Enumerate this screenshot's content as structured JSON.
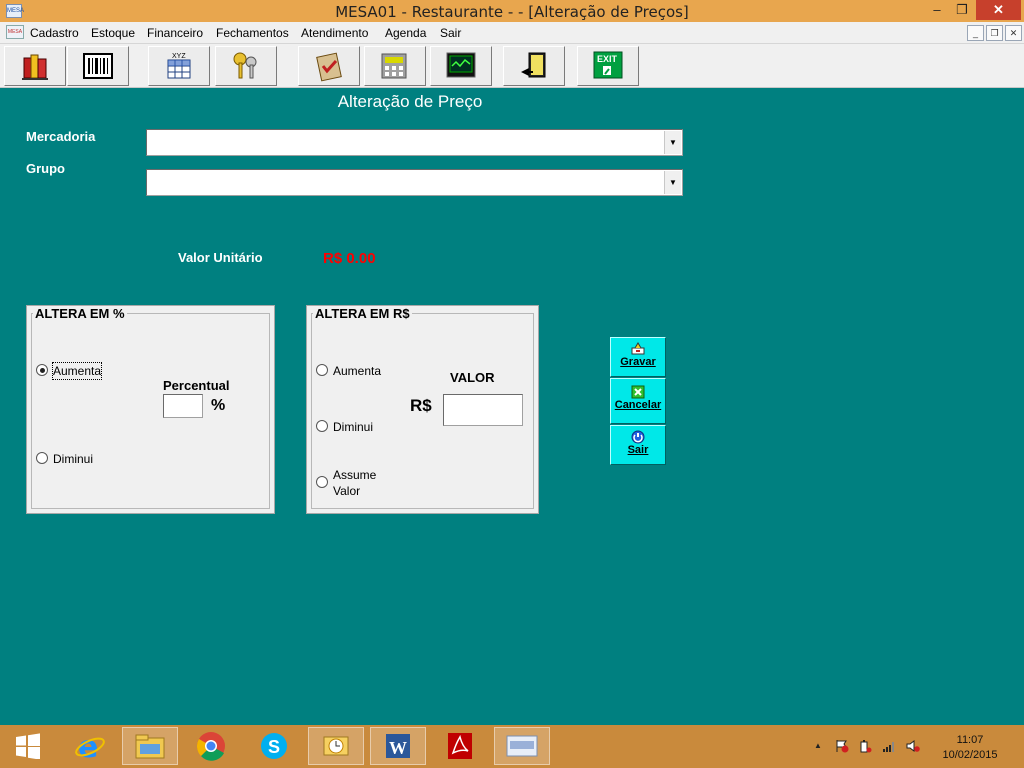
{
  "window": {
    "title": "MESA01 - Restaurante -  - [Alteração de Preços]",
    "app_icon_text": "MESA",
    "controls": {
      "minimize": "–",
      "restore": "❐",
      "close": "✕"
    }
  },
  "menubar": {
    "items": [
      "Cadastro",
      "Estoque",
      "Financeiro",
      "Fechamentos",
      "Atendimento",
      "Agenda",
      "Sair"
    ],
    "mdi_controls": {
      "minimize": "_",
      "restore": "❐",
      "close": "✕"
    }
  },
  "toolbar": {
    "buttons": [
      {
        "icon": "books-icon"
      },
      {
        "icon": "barcode-icon"
      },
      {
        "icon": "xyz-table-icon",
        "text": "XYZ"
      },
      {
        "icon": "keys-icon"
      },
      {
        "icon": "clipboard-check-icon"
      },
      {
        "icon": "calculator-icon"
      },
      {
        "icon": "monitor-chart-icon"
      },
      {
        "icon": "exit-door-icon"
      },
      {
        "icon": "exit-sign-icon",
        "text": "EXIT"
      }
    ]
  },
  "form": {
    "title": "Alteração de Preço",
    "mercadoria_label": "Mercadoria",
    "mercadoria_value": "",
    "grupo_label": "Grupo",
    "grupo_value": "",
    "valor_unitario_label": "Valor Unitário",
    "valor_unitario_value": "R$ 0.00",
    "valor_color": "#ff0000",
    "background_color": "#008080"
  },
  "group_percent": {
    "legend": "ALTERA EM %",
    "options": [
      "Aumenta",
      "Diminui"
    ],
    "selected": "Aumenta",
    "percentual_label": "Percentual",
    "percent_sign": "%",
    "percentual_value": ""
  },
  "group_real": {
    "legend": "ALTERA EM R$",
    "options": [
      "Aumenta",
      "Diminui",
      "Assume Valor"
    ],
    "option_assume_line1": "Assume",
    "option_assume_line2": "Valor",
    "valor_label": "VALOR",
    "currency_label": "R$",
    "valor_value": ""
  },
  "actions": [
    {
      "label": "Gravar",
      "icon": "save-icon"
    },
    {
      "label": "Cancelar",
      "icon": "cancel-icon"
    },
    {
      "label": "Sair",
      "icon": "power-icon"
    }
  ],
  "taskbar": {
    "apps": [
      "windows-start",
      "internet-explorer",
      "file-explorer",
      "chrome",
      "skype",
      "outlook",
      "word",
      "acrobat-reader",
      "mesa-app"
    ],
    "tray_arrow": "▲",
    "clock_time": "11:07",
    "clock_date": "10/02/2015"
  }
}
